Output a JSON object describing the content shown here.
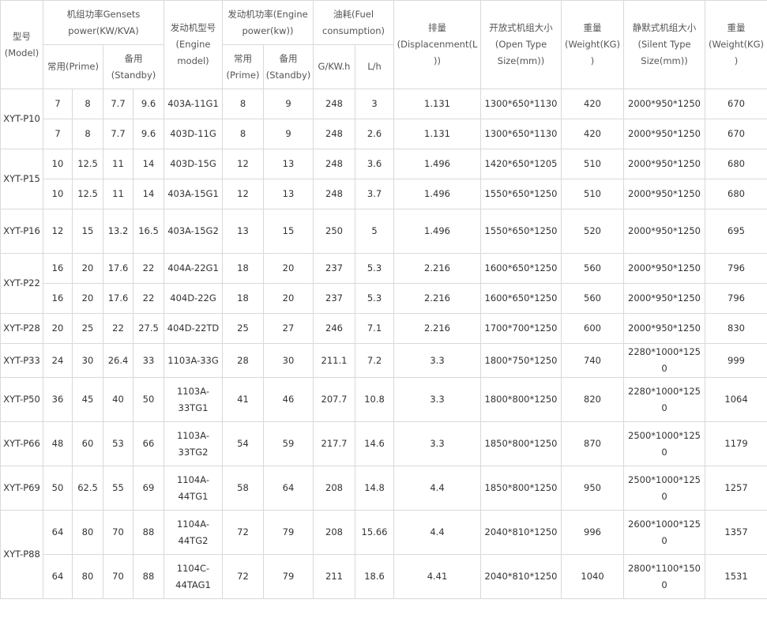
{
  "headers": {
    "model": "型号(Model)",
    "genset_power": "机组功率Gensets power(KW/KVA)",
    "prime": "常用(Prime)",
    "standby_genset": "备用(Standby)",
    "engine_model": "发动机型号(Engine model)",
    "engine_power": "发动机功率(Engine power(kw))",
    "engine_prime": "常用(Prime)",
    "engine_standby": "备用(Standby)",
    "fuel": "油耗(Fuel consumption)",
    "fuel_gkwh": "G/KW.h",
    "fuel_lh": "L/h",
    "displacement": "排量(Displacenment(L))",
    "open_size": "开放式机组大小(Open Type Size(mm))",
    "open_weight": "重量(Weight(KG))",
    "silent_size": "静默式机组大小(Silent Type Size(mm))",
    "silent_weight": "重量(Weight(KG))"
  },
  "groups": [
    {
      "model": "XYT-P10",
      "rows": [
        [
          "7",
          "8",
          "7.7",
          "9.6",
          "403A-11G1",
          "8",
          "9",
          "248",
          "3",
          "1.131",
          "1300*650*1130",
          "420",
          "2000*950*1250",
          "670"
        ],
        [
          "7",
          "8",
          "7.7",
          "9.6",
          "403D-11G",
          "8",
          "9",
          "248",
          "2.6",
          "1.131",
          "1300*650*1130",
          "420",
          "2000*950*1250",
          "670"
        ]
      ]
    },
    {
      "model": "XYT-P15",
      "rows": [
        [
          "10",
          "12.5",
          "11",
          "14",
          "403D-15G",
          "12",
          "13",
          "248",
          "3.6",
          "1.496",
          "1420*650*1205",
          "510",
          "2000*950*1250",
          "680"
        ],
        [
          "10",
          "12.5",
          "11",
          "14",
          "403A-15G1",
          "12",
          "13",
          "248",
          "3.7",
          "1.496",
          "1550*650*1250",
          "510",
          "2000*950*1250",
          "680"
        ]
      ]
    },
    {
      "model": "XYT-P16",
      "rows": [
        [
          "12",
          "15",
          "13.2",
          "16.5",
          "403A-15G2",
          "13",
          "15",
          "250",
          "5",
          "1.496",
          "1550*650*1250",
          "520",
          "2000*950*1250",
          "695"
        ]
      ]
    },
    {
      "model": "XYT-P22",
      "rows": [
        [
          "16",
          "20",
          "17.6",
          "22",
          "404A-22G1",
          "18",
          "20",
          "237",
          "5.3",
          "2.216",
          "1600*650*1250",
          "560",
          "2000*950*1250",
          "796"
        ],
        [
          "16",
          "20",
          "17.6",
          "22",
          "404D-22G",
          "18",
          "20",
          "237",
          "5.3",
          "2.216",
          "1600*650*1250",
          "560",
          "2000*950*1250",
          "796"
        ]
      ]
    },
    {
      "model": "XYT-P28",
      "rows": [
        [
          "20",
          "25",
          "22",
          "27.5",
          "404D-22TD",
          "25",
          "27",
          "246",
          "7.1",
          "2.216",
          "1700*700*1250",
          "600",
          "2000*950*1250",
          "830"
        ]
      ]
    },
    {
      "model": "XYT-P33",
      "rows": [
        [
          "24",
          "30",
          "26.4",
          "33",
          "1103A-33G",
          "28",
          "30",
          "211.1",
          "7.2",
          "3.3",
          "1800*750*1250",
          "740",
          "2280*1000*1250",
          "999"
        ]
      ]
    },
    {
      "model": "XYT-P50",
      "rows": [
        [
          "36",
          "45",
          "40",
          "50",
          "1103A-33TG1",
          "41",
          "46",
          "207.7",
          "10.8",
          "3.3",
          "1800*800*1250",
          "820",
          "2280*1000*1250",
          "1064"
        ]
      ]
    },
    {
      "model": "XYT-P66",
      "rows": [
        [
          "48",
          "60",
          "53",
          "66",
          "1103A-33TG2",
          "54",
          "59",
          "217.7",
          "14.6",
          "3.3",
          "1850*800*1250",
          "870",
          "2500*1000*1250",
          "1179"
        ]
      ]
    },
    {
      "model": "XYT-P69",
      "rows": [
        [
          "50",
          "62.5",
          "55",
          "69",
          "1104A-44TG1",
          "58",
          "64",
          "208",
          "14.8",
          "4.4",
          "1850*800*1250",
          "950",
          "2500*1000*1250",
          "1257"
        ]
      ]
    },
    {
      "model": "XYT-P88",
      "rows": [
        [
          "64",
          "80",
          "70",
          "88",
          "1104A-44TG2",
          "72",
          "79",
          "208",
          "15.66",
          "4.4",
          "2040*810*1250",
          "996",
          "2600*1000*1250",
          "1357"
        ],
        [
          "64",
          "80",
          "70",
          "88",
          "1104C-44TAG1",
          "72",
          "79",
          "211",
          "18.6",
          "4.41",
          "2040*810*1250",
          "1040",
          "2800*1100*1500",
          "1531"
        ]
      ]
    }
  ]
}
